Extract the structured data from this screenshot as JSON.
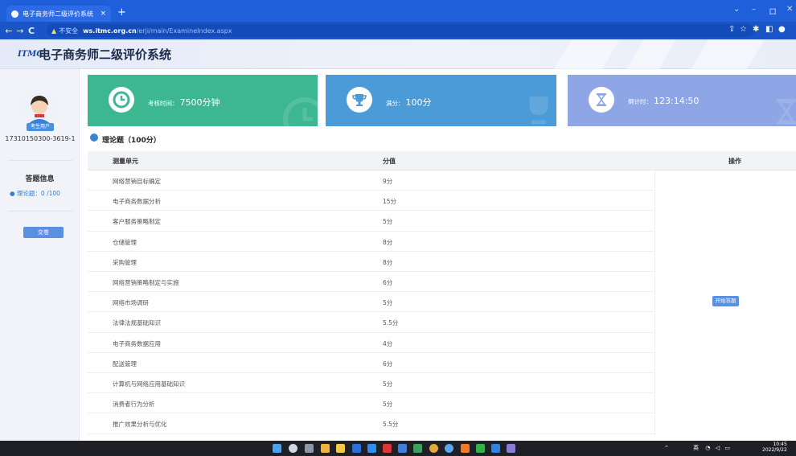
{
  "browser": {
    "tab_title": "电子商务师二级评价系统",
    "tab_close": "×",
    "new_tab": "+",
    "back": "←",
    "forward": "→",
    "reload": "C",
    "insecure_label": "不安全",
    "url_host": "ws.itmc.org.cn",
    "url_path": "/erji/main/ExamineIndex.aspx",
    "win_min": "–",
    "win_max": "ロ",
    "win_close": "✕",
    "win_chev": "⌄"
  },
  "header": {
    "logo": "ITMC",
    "title": "电子商务师二级评价系统"
  },
  "sidebar": {
    "role_badge": "考生用户",
    "user_id": "17310150300-3619-1",
    "answer_info_label": "答题信息",
    "theory_progress": "● 理论题：0 /100",
    "submit_label": "交卷"
  },
  "cards": [
    {
      "label": "考核时间：",
      "value": "7500分钟",
      "icon": "clock-icon",
      "color": "#3cb790"
    },
    {
      "label": "满分：",
      "value": "100分",
      "icon": "trophy-icon",
      "color": "#4b9bd8"
    },
    {
      "label": "倒计时：",
      "value": "123:14:50",
      "icon": "hourglass-icon",
      "color": "#8ea6e6"
    }
  ],
  "section": {
    "title": "理论题（100分）"
  },
  "table": {
    "headers": [
      "测量单元",
      "分值",
      "操作"
    ],
    "rows": [
      {
        "unit": "网络营销目标确定",
        "score": "9分"
      },
      {
        "unit": "电子商务数据分析",
        "score": "15分"
      },
      {
        "unit": "客户服务策略制定",
        "score": "5分"
      },
      {
        "unit": "仓储管理",
        "score": "8分"
      },
      {
        "unit": "采购管理",
        "score": "8分"
      },
      {
        "unit": "网络营销策略制定与实施",
        "score": "6分"
      },
      {
        "unit": "网络市场调研",
        "score": "5分"
      },
      {
        "unit": "法律法规基础知识",
        "score": "5.5分"
      },
      {
        "unit": "电子商务数据应用",
        "score": "4分"
      },
      {
        "unit": "配送管理",
        "score": "6分"
      },
      {
        "unit": "计算机与网络应用基础知识",
        "score": "5分"
      },
      {
        "unit": "消费者行为分析",
        "score": "5分"
      },
      {
        "unit": "推广效果分析与优化",
        "score": "5.5分"
      }
    ],
    "start_button": "开始答题"
  },
  "taskbar": {
    "time": "10:45",
    "date": "2022/9/22",
    "lang": "英"
  }
}
